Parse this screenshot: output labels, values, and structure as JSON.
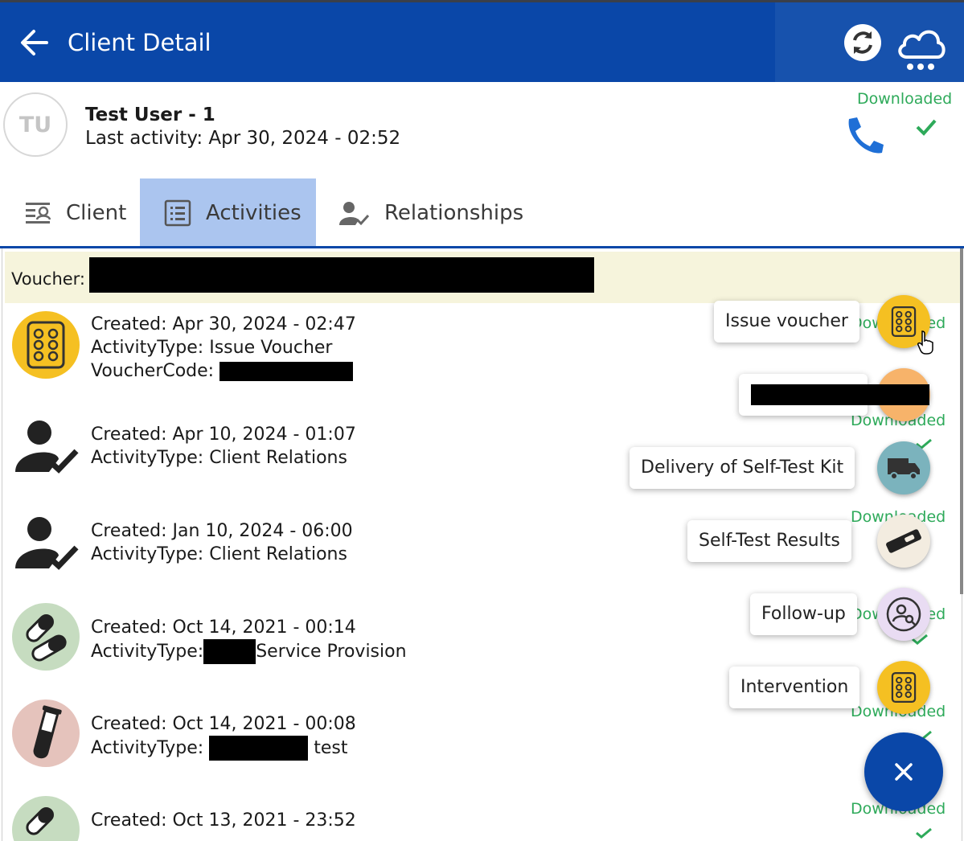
{
  "header": {
    "title": "Client Detail",
    "back_icon": "arrow-left-icon",
    "sync_icon": "sync-icon",
    "cloud_icon": "cloud-sync-icon",
    "bar_color": "#0a47a8"
  },
  "client": {
    "initials": "TU",
    "name": "Test User - 1",
    "last_activity": "Last activity: Apr 30, 2024 - 02:52",
    "sync_status": "Downloaded",
    "phone_icon": "phone-icon"
  },
  "tabs": [
    {
      "label": "Client",
      "icon": "client-profile-icon",
      "active": false
    },
    {
      "label": "Activities",
      "icon": "list-icon",
      "active": true
    },
    {
      "label": "Relationships",
      "icon": "user-check-icon",
      "active": false
    }
  ],
  "voucher": {
    "label": "Voucher:"
  },
  "activities": [
    {
      "created": "Created: Apr 30, 2024 - 02:47",
      "type_prefix": "ActivityType:",
      "type": "Issue Voucher",
      "extra_label": "VoucherCode:",
      "icon": "pills-icon",
      "status": "Downloaded"
    },
    {
      "created": "Created: Apr 10, 2024 - 01:07",
      "type_prefix": "ActivityType:",
      "type": "Client Relations",
      "icon": "user-check-icon",
      "status": "Downloaded"
    },
    {
      "created": "Created: Jan 10, 2024 - 06:00",
      "type_prefix": "ActivityType:",
      "type": "Client Relations",
      "icon": "user-check-icon",
      "status": "Downloaded"
    },
    {
      "created": "Created: Oct 14, 2021 - 00:14",
      "type_prefix": "ActivityType:",
      "type": "Service Provision",
      "icon": "capsules-icon",
      "status": "Downloaded"
    },
    {
      "created": "Created: Oct 14, 2021 - 00:08",
      "type_prefix": "ActivityType:",
      "type": "test",
      "icon": "test-tube-icon",
      "status": "Downloaded"
    },
    {
      "created": "Created: Oct 13, 2021 - 23:52",
      "icon": "capsules-icon",
      "status": "Downloaded"
    }
  ],
  "fab_menu": {
    "items": [
      {
        "label": "Issue voucher",
        "icon": "pills-icon",
        "color": "#f5c022"
      },
      {
        "label": "",
        "icon": "hand-icon",
        "color": "#f7b36a"
      },
      {
        "label": "Delivery of Self-Test Kit",
        "icon": "delivery-truck-icon",
        "color": "#7bb3bd"
      },
      {
        "label": "Self-Test Results",
        "icon": "self-test-icon",
        "color": "#f3ece0"
      },
      {
        "label": "Follow-up",
        "icon": "follow-up-icon",
        "color": "#e9dcf3"
      },
      {
        "label": "Intervention",
        "icon": "pills-icon",
        "color": "#f5c022"
      }
    ],
    "close_icon": "close-icon"
  }
}
